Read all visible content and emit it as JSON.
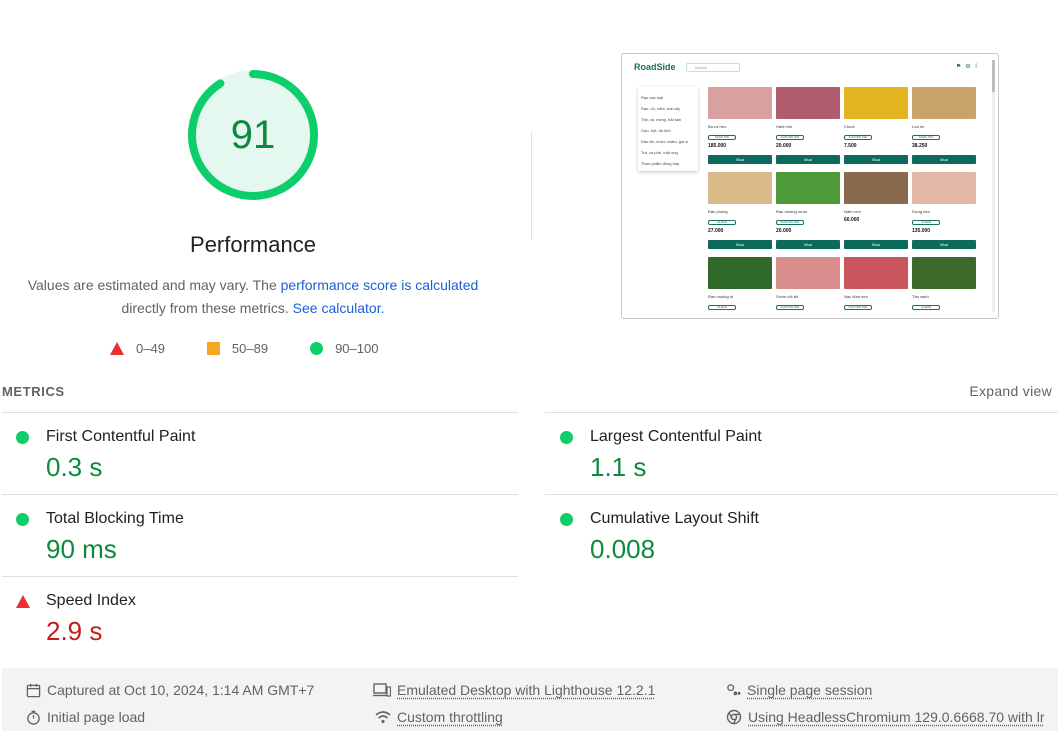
{
  "performance": {
    "score": 91,
    "title": "Performance",
    "description_pre": "Values are estimated and may vary. The ",
    "description_link": "performance score is calculated",
    "description_mid": "directly from these metrics. ",
    "calculator_link": "See calculator.",
    "gauge_color": "#0cce6b",
    "gauge_fill": "#e5f8ef"
  },
  "legend": {
    "fail": "0–49",
    "average": "50–89",
    "pass": "90–100"
  },
  "thumbnail": {
    "logo": "RoadSide",
    "search_placeholder": "Search",
    "categories": [
      "Rau các loại",
      "Rau, củ, nấm, trái cây",
      "Thịt, cá, trứng, hải sản",
      "Gạo, bột, đồ khô",
      "Dầu ăn, nước chấm, gia vị",
      "Trà, cà phê, mật ong",
      "Thực phẩm đóng hộp"
    ],
    "products": [
      {
        "name": "Ba rọi heo",
        "tag": "GIẢM 10K",
        "price": "185.000",
        "color": "#d9a0a0"
      },
      {
        "name": "Hành tím",
        "tag": "KHUYẾN MÃI",
        "price": "20.000",
        "color": "#b05b6e"
      },
      {
        "name": "Chuối",
        "tag": "KHUYẾN MÃI",
        "price": "7.500",
        "color": "#e3b520"
      },
      {
        "name": "Lúa mì",
        "tag": "GIẢM 10%",
        "price": "38.250",
        "color": "#c9a46a"
      },
      {
        "name": "Đậu phộng",
        "tag": "CLEAN",
        "price": "27.000",
        "color": "#d8b98a"
      },
      {
        "name": "Rau muống nước",
        "tag": "KHUYẾN MÃI",
        "price": "20.000",
        "color": "#4e9a3a"
      },
      {
        "name": "Nấm rơm",
        "tag": "",
        "price": "60.000",
        "color": "#8a6a4e"
      },
      {
        "name": "Dựng heo",
        "tag": "CLEAN",
        "price": "135.000",
        "color": "#e2b7a8"
      },
      {
        "name": "Rau muống lá",
        "tag": "CLEAN",
        "price": "",
        "color": "#2f6a2a"
      },
      {
        "name": "Sườn cốt lết",
        "tag": "KHUYẾN MÃI",
        "price": "",
        "color": "#d98c8c"
      },
      {
        "name": "Nạc đùm heo",
        "tag": "KHUYẾN MÃI",
        "price": "",
        "color": "#c9565e"
      },
      {
        "name": "Tảo xanh",
        "tag": "CLEAN",
        "price": "",
        "color": "#3d6b2c"
      }
    ],
    "buy_label": "Mua"
  },
  "metrics": {
    "header": "METRICS",
    "expand": "Expand view",
    "fcp": {
      "label": "First Contentful Paint",
      "value": "0.3 s"
    },
    "lcp": {
      "label": "Largest Contentful Paint",
      "value": "1.1 s"
    },
    "tbt": {
      "label": "Total Blocking Time",
      "value": "90 ms"
    },
    "cls": {
      "label": "Cumulative Layout Shift",
      "value": "0.008"
    },
    "si": {
      "label": "Speed Index",
      "value": "2.9 s"
    }
  },
  "footer": {
    "captured": "Captured at Oct 10, 2024, 1:14 AM GMT+7",
    "initial_load": "Initial page load",
    "emulated": "Emulated Desktop with Lighthouse 12.2.1",
    "throttling": "Custom throttling",
    "session": "Single page session",
    "browser": "Using HeadlessChromium 129.0.6668.70 with lr"
  }
}
